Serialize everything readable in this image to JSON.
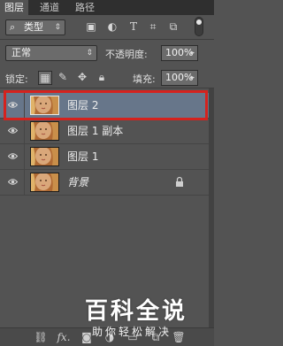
{
  "tabs": [
    "图层",
    "通道",
    "路径"
  ],
  "filter": {
    "kind_label": "类型",
    "icons": [
      "image-filter-icon",
      "adjustment-filter-icon",
      "type-filter-icon",
      "shape-filter-icon",
      "smart-object-filter-icon"
    ]
  },
  "blend": {
    "mode": "正常",
    "opacity_label": "不透明度:",
    "opacity_value": "100%"
  },
  "lock": {
    "label": "锁定:",
    "fill_label": "填充:",
    "fill_value": "100%"
  },
  "layers": [
    {
      "name": "图层 2",
      "selected": true,
      "visible": true,
      "locked": false
    },
    {
      "name": "图层 1 副本",
      "selected": false,
      "visible": true,
      "locked": false
    },
    {
      "name": "图层 1",
      "selected": false,
      "visible": true,
      "locked": false
    },
    {
      "name": "背景",
      "selected": false,
      "visible": true,
      "locked": true
    }
  ],
  "bottom_bar": {
    "fx_label": "fx."
  },
  "watermark": {
    "title": "百科全说",
    "subtitle": "助你轻松解决"
  },
  "colors": {
    "panel_bg": "#535353",
    "selected_row": "#67768a",
    "highlight_border": "#d5221e"
  }
}
